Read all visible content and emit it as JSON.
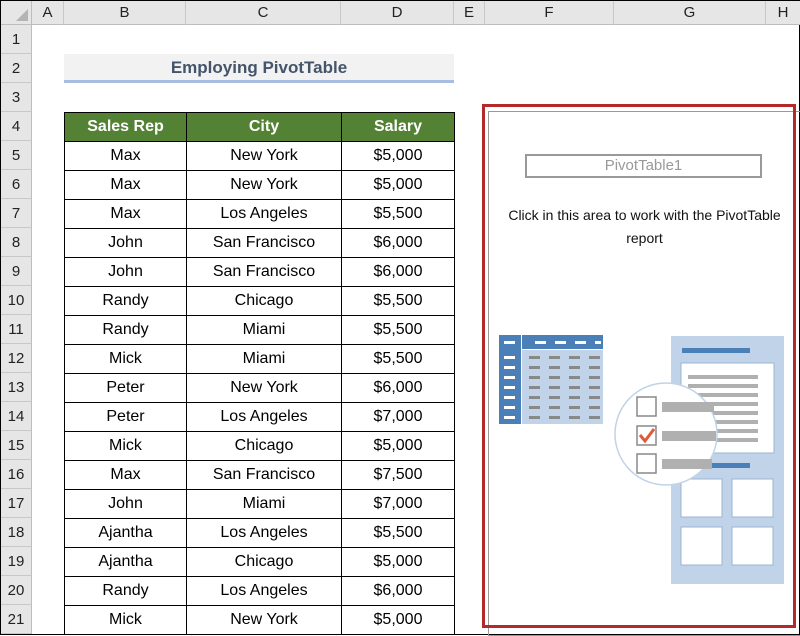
{
  "columns": [
    "A",
    "B",
    "C",
    "D",
    "E",
    "F",
    "G",
    "H"
  ],
  "rows": [
    "1",
    "2",
    "3",
    "4",
    "5",
    "6",
    "7",
    "8",
    "9",
    "10",
    "11",
    "12",
    "13",
    "14",
    "15",
    "16",
    "17",
    "18",
    "19",
    "20",
    "21"
  ],
  "title": "Employing PivotTable",
  "table": {
    "headers": [
      "Sales Rep",
      "City",
      "Salary"
    ],
    "rows": [
      [
        "Max",
        "New York",
        "$5,000"
      ],
      [
        "Max",
        "New York",
        "$5,000"
      ],
      [
        "Max",
        "Los Angeles",
        "$5,500"
      ],
      [
        "John",
        "San Francisco",
        "$6,000"
      ],
      [
        "John",
        "San Francisco",
        "$6,000"
      ],
      [
        "Randy",
        "Chicago",
        "$5,500"
      ],
      [
        "Randy",
        "Miami",
        "$5,500"
      ],
      [
        "Mick",
        "Miami",
        "$5,500"
      ],
      [
        "Peter",
        "New York",
        "$6,000"
      ],
      [
        "Peter",
        "Los Angeles",
        "$7,000"
      ],
      [
        "Mick",
        "Chicago",
        "$5,000"
      ],
      [
        "Max",
        "San Francisco",
        "$7,500"
      ],
      [
        "John",
        "Miami",
        "$7,000"
      ],
      [
        "Ajantha",
        "Los Angeles",
        "$5,500"
      ],
      [
        "Ajantha",
        "Chicago",
        "$5,000"
      ],
      [
        "Randy",
        "Los Angeles",
        "$6,000"
      ],
      [
        "Mick",
        "New York",
        "$5,000"
      ]
    ]
  },
  "pivot": {
    "name": "PivotTable1",
    "message": "Click in this area to work with the PivotTable report"
  },
  "colors": {
    "header_green": "#548235",
    "highlight_red": "#b22a2a",
    "pivot_blue": "#4a7fb8"
  }
}
